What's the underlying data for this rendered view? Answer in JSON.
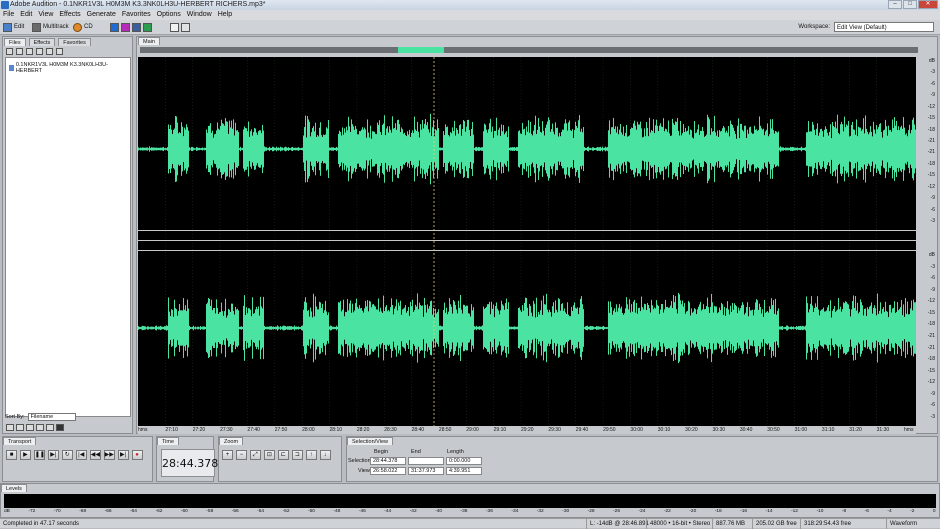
{
  "window": {
    "title": "Adobe Audition - 0.1NKR1V3L H0M3M K3.3NK0LH3U-HERBERT RICHERS.mp3*"
  },
  "menu": [
    "File",
    "Edit",
    "View",
    "Effects",
    "Generate",
    "Favorites",
    "Options",
    "Window",
    "Help"
  ],
  "toolbar": {
    "edit_label": "Edit",
    "multitrack_label": "Multitrack",
    "cd_label": "CD"
  },
  "workspace": {
    "label": "Workspace:",
    "value": "Edit View (Default)"
  },
  "files_panel": {
    "tabs": [
      "Files",
      "Effects",
      "Favorites"
    ],
    "file_name": "0.1NKR1V3L H0M3M K3.3NK0LH3U-HERBERT",
    "sort_label": "Sort By:",
    "sort_value": "Filename"
  },
  "main_panel": {
    "tab": "Main"
  },
  "db_ruler": {
    "top": [
      "dB",
      "-3",
      "-6",
      "-9",
      "-12",
      "-15",
      "-18",
      "-21",
      "-21",
      "-18",
      "-15",
      "-12",
      "-9",
      "-6",
      "-3"
    ],
    "bottom": [
      "dB",
      "-3",
      "-6",
      "-9",
      "-12",
      "-15",
      "-18",
      "-21",
      "-21",
      "-18",
      "-15",
      "-12",
      "-9",
      "-6",
      "-3"
    ]
  },
  "time_ruler": [
    "hms",
    "27:10",
    "27:20",
    "27:30",
    "27:40",
    "27:50",
    "28:00",
    "28:10",
    "28:20",
    "28:30",
    "28:40",
    "28:50",
    "29:00",
    "29:10",
    "29:20",
    "29:30",
    "29:40",
    "29:50",
    "30:00",
    "30:10",
    "30:20",
    "30:30",
    "30:40",
    "30:50",
    "31:00",
    "31:10",
    "31:20",
    "31:30",
    "hms"
  ],
  "transport": {
    "title": "Transport"
  },
  "time": {
    "title": "Time",
    "value": "28:44.378"
  },
  "zoom": {
    "title": "Zoom"
  },
  "selection": {
    "title": "Selection/View",
    "col_begin": "Begin",
    "col_end": "End",
    "col_length": "Length",
    "row_selection": "Selection",
    "row_view": "View",
    "sel_begin": "28:44.378",
    "sel_end": "",
    "sel_length": "0:00.000",
    "view_begin": "26:58.022",
    "view_end": "31:37.973",
    "view_length": "4:39.951"
  },
  "levels": {
    "title": "Levels",
    "scale": [
      "dB",
      "-72",
      "-70",
      "-68",
      "-66",
      "-64",
      "-62",
      "-60",
      "-58",
      "-56",
      "-54",
      "-52",
      "-50",
      "-48",
      "-46",
      "-44",
      "-42",
      "-40",
      "-38",
      "-36",
      "-34",
      "-32",
      "-30",
      "-28",
      "-26",
      "-24",
      "-22",
      "-20",
      "-18",
      "-16",
      "-14",
      "-12",
      "-10",
      "-8",
      "-6",
      "-4",
      "-2",
      "0"
    ]
  },
  "status": {
    "completed": "Completed in 47.17 seconds",
    "cursor": "L: -14dB @ 28:46.891",
    "format": "48000 • 16-bit • Stereo",
    "size": "887.76 MB",
    "free": "205.02 GB free",
    "time_free": "318:29:54.43 free",
    "view": "Waveform"
  },
  "colors": {
    "waveform": "#4be3a2",
    "background": "#000000"
  }
}
